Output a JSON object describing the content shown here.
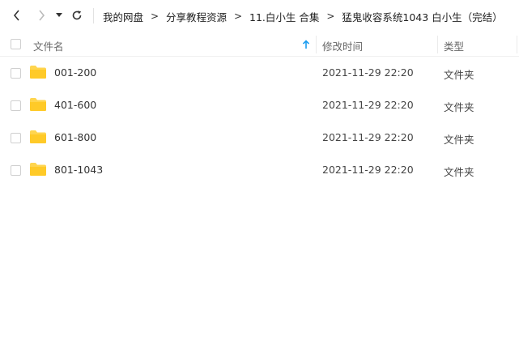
{
  "toolbar": {
    "back_icon": "chevron-left-icon",
    "forward_icon": "chevron-right-icon",
    "dropdown_icon": "caret-down-icon",
    "refresh_icon": "refresh-icon"
  },
  "breadcrumb": {
    "items": [
      "我的网盘",
      "分享教程资源",
      "11.白小生 合集",
      "猛鬼收容系统1043 白小生（完结）"
    ],
    "separator": ">"
  },
  "table": {
    "headers": {
      "name": "文件名",
      "modified": "修改时间",
      "type": "类型"
    },
    "sort_icon": "arrow-up-icon",
    "rows": [
      {
        "name": "001-200",
        "modified": "2021-11-29 22:20",
        "type": "文件夹"
      },
      {
        "name": "401-600",
        "modified": "2021-11-29 22:20",
        "type": "文件夹"
      },
      {
        "name": "601-800",
        "modified": "2021-11-29 22:20",
        "type": "文件夹"
      },
      {
        "name": "801-1043",
        "modified": "2021-11-29 22:20",
        "type": "文件夹"
      }
    ]
  },
  "colors": {
    "folder": "#FFD54F",
    "sort_accent": "#1a9cf0",
    "text": "#333333",
    "header_text": "#666666"
  }
}
